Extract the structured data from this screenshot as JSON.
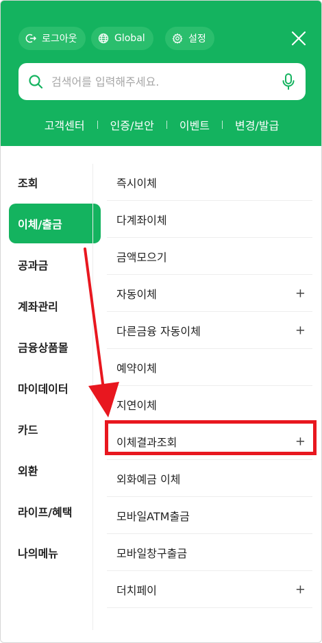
{
  "header": {
    "logout_label": "로그아웃",
    "global_label": "Global",
    "settings_label": "설정",
    "close_icon": "close-icon"
  },
  "search": {
    "placeholder": "검색어를 입력해주세요."
  },
  "quick_links": [
    "고객센터",
    "인증/보안",
    "이벤트",
    "변경/발급"
  ],
  "categories": [
    {
      "label": "조회"
    },
    {
      "label": "이체/출금",
      "active": true
    },
    {
      "label": "공과금"
    },
    {
      "label": "계좌관리"
    },
    {
      "label": "금융상품몰"
    },
    {
      "label": "마이데이터"
    },
    {
      "label": "카드"
    },
    {
      "label": "외환"
    },
    {
      "label": "라이프/혜택"
    },
    {
      "label": "나의메뉴"
    }
  ],
  "submenu": [
    {
      "label": "즉시이체",
      "expandable": false
    },
    {
      "label": "다계좌이체",
      "expandable": false
    },
    {
      "label": "금액모으기",
      "expandable": false
    },
    {
      "label": "자동이체",
      "expandable": true
    },
    {
      "label": "다른금융 자동이체",
      "expandable": true
    },
    {
      "label": "예약이체",
      "expandable": false
    },
    {
      "label": "지연이체",
      "expandable": false
    },
    {
      "label": "이체결과조회",
      "expandable": true,
      "highlighted": true
    },
    {
      "label": "외화예금 이체",
      "expandable": false
    },
    {
      "label": "모바일ATM출금",
      "expandable": false
    },
    {
      "label": "모바일창구출금",
      "expandable": false
    },
    {
      "label": "더치페이",
      "expandable": true
    }
  ],
  "expand_symbol": "+",
  "colors": {
    "brand_green": "#14b35f",
    "pill_green": "#2bbe6d",
    "highlight_red": "#e8171f"
  }
}
